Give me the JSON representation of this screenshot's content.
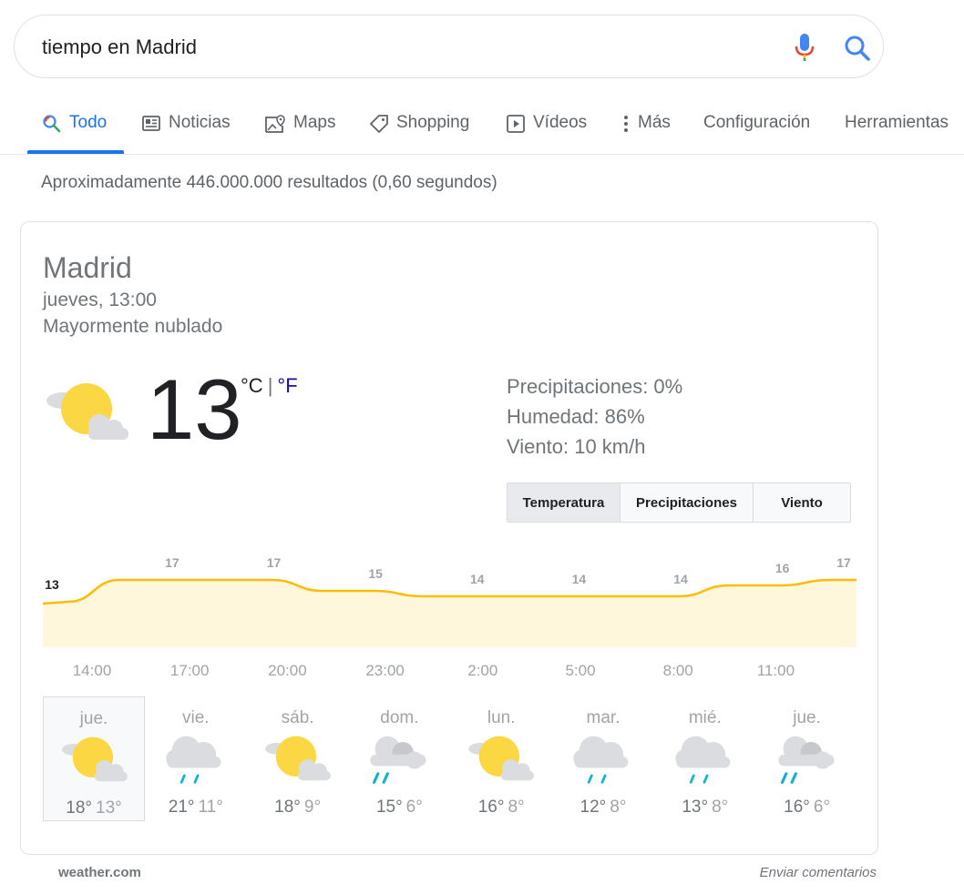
{
  "search": {
    "query": "tiempo en Madrid"
  },
  "tabs": [
    {
      "label": "Todo",
      "icon": "search-icon",
      "active": true
    },
    {
      "label": "Noticias",
      "icon": "newspaper-icon"
    },
    {
      "label": "Maps",
      "icon": "map-icon"
    },
    {
      "label": "Shopping",
      "icon": "tag-icon"
    },
    {
      "label": "Vídeos",
      "icon": "play-icon"
    },
    {
      "label": "Más",
      "icon": "more-vert-icon"
    },
    {
      "label": "Configuración"
    },
    {
      "label": "Herramientas"
    }
  ],
  "results_stats": "Aproximadamente 446.000.000 resultados (0,60 segundos)",
  "weather": {
    "location": "Madrid",
    "datetime": "jueves, 13:00",
    "condition": "Mayormente nublado",
    "temperature": "13",
    "unit_c": "°C",
    "unit_sep": "|",
    "unit_f": "°F",
    "current_icon": "partly-cloudy-icon",
    "details": {
      "precipitation": "Precipitaciones: 0%",
      "humidity": "Humedad: 86%",
      "wind": "Viento: 10 km/h"
    },
    "toggle": [
      {
        "label": "Temperatura",
        "active": true
      },
      {
        "label": "Precipitaciones"
      },
      {
        "label": "Viento"
      }
    ]
  },
  "chart_data": {
    "type": "area",
    "series": [
      {
        "values": [
          13,
          17,
          17,
          15,
          14,
          14,
          14,
          16,
          17
        ]
      }
    ],
    "point_labels": [
      "13",
      "17",
      "17",
      "15",
      "14",
      "14",
      "14",
      "16",
      "17"
    ],
    "x_labels": [
      "14:00",
      "17:00",
      "20:00",
      "23:00",
      "2:00",
      "5:00",
      "8:00",
      "11:00"
    ],
    "colors": {
      "line": "#fbbc04",
      "fill": "#fef7dc"
    }
  },
  "forecast": [
    {
      "day": "jue.",
      "hi": "18°",
      "lo": "13°",
      "icon": "partly-cloudy-icon",
      "selected": true
    },
    {
      "day": "vie.",
      "hi": "21°",
      "lo": "11°",
      "icon": "rain-icon"
    },
    {
      "day": "sáb.",
      "hi": "18°",
      "lo": "9°",
      "icon": "partly-cloudy-icon"
    },
    {
      "day": "dom.",
      "hi": "15°",
      "lo": "6°",
      "icon": "cloudy-rain-icon"
    },
    {
      "day": "lun.",
      "hi": "16°",
      "lo": "8°",
      "icon": "partly-cloudy-icon"
    },
    {
      "day": "mar.",
      "hi": "12°",
      "lo": "8°",
      "icon": "rain-icon"
    },
    {
      "day": "mié.",
      "hi": "13°",
      "lo": "8°",
      "icon": "rain-icon"
    },
    {
      "day": "jue.",
      "hi": "16°",
      "lo": "6°",
      "icon": "cloudy-rain-icon"
    }
  ],
  "footer": {
    "source": "weather.com",
    "feedback": "Enviar comentarios"
  }
}
